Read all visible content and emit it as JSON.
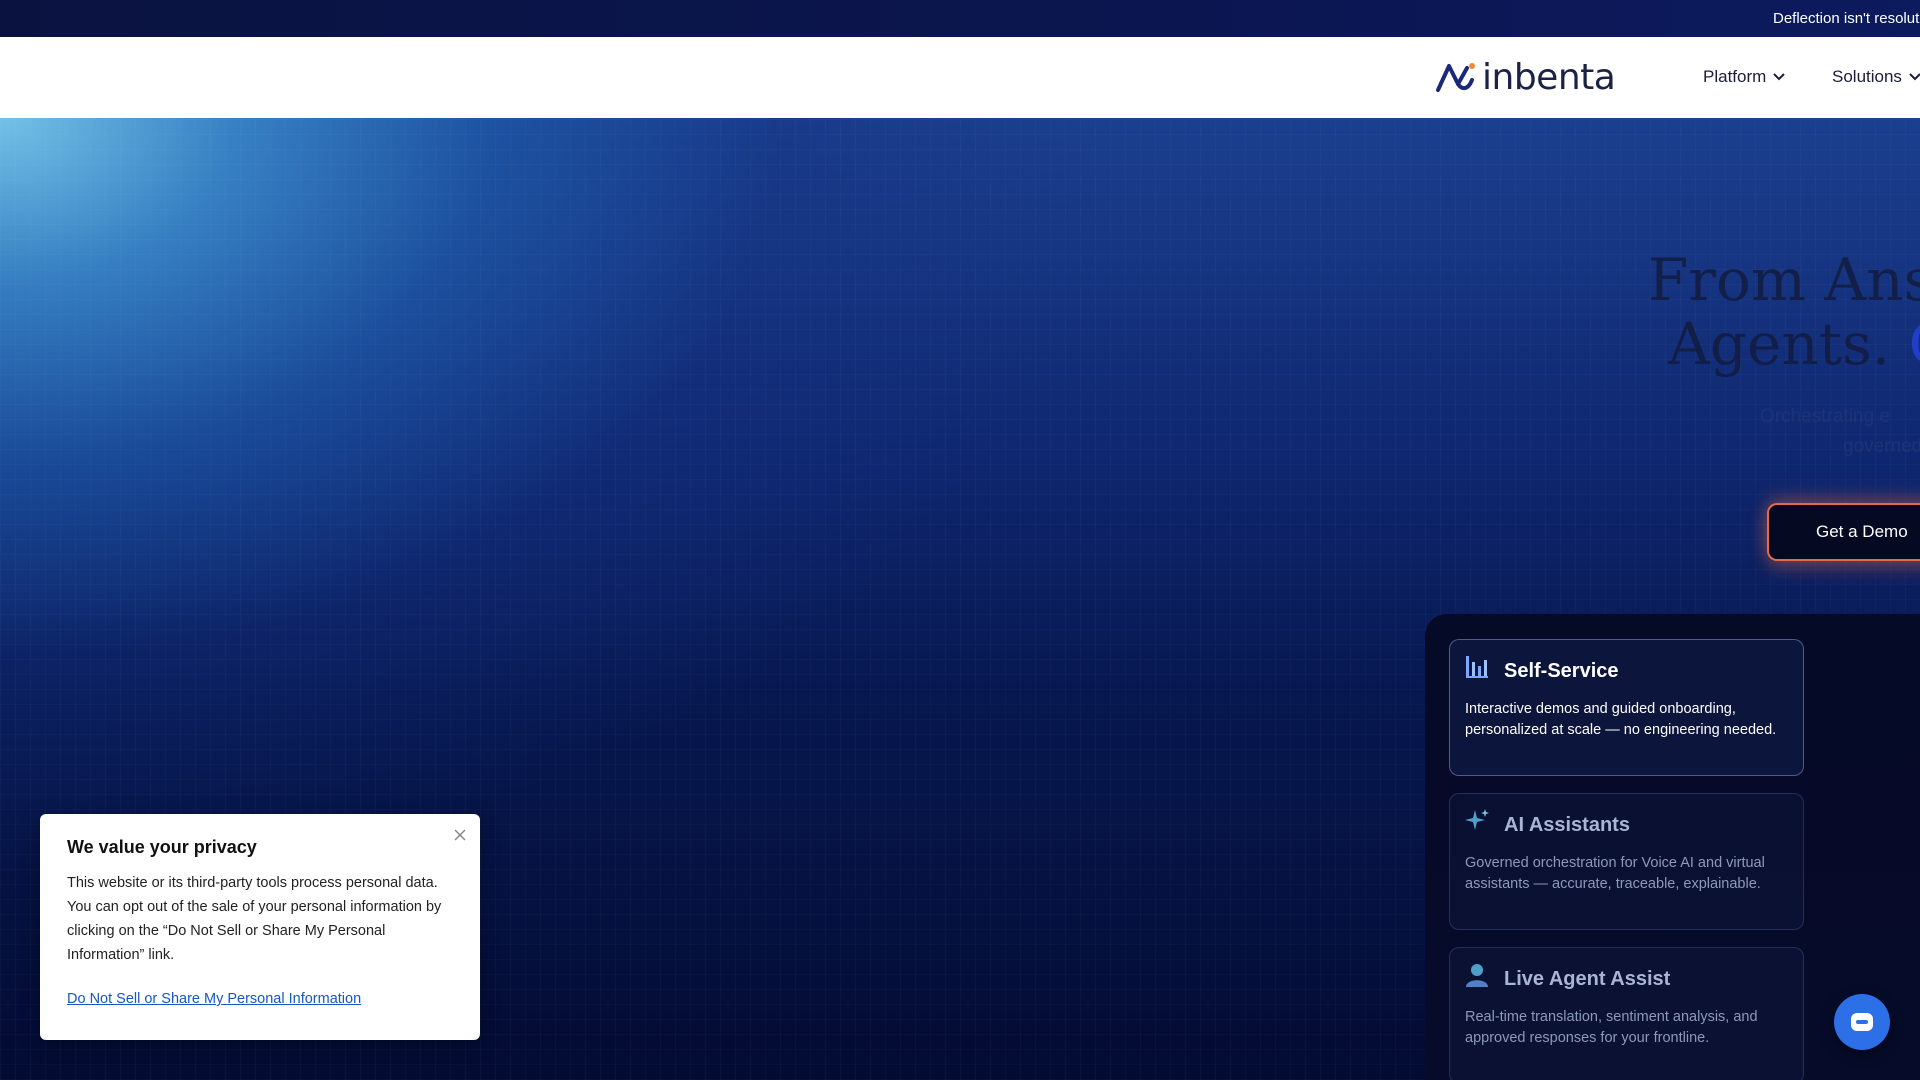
{
  "announcement": {
    "text": "Deflection isn't resolut"
  },
  "nav": {
    "logo_text": "inbenta",
    "items": [
      {
        "label": "Platform"
      },
      {
        "label": "Solutions"
      }
    ]
  },
  "hero": {
    "headline_line1": "From Ansv",
    "headline_line2_start": "Agents.",
    "headline_line2_accent": "Or",
    "subtext_line1": "Orchestrating e",
    "subtext_line2": "governed",
    "cta_label": "Get a Demo"
  },
  "cards": [
    {
      "title": "Self-Service",
      "desc": "Interactive demos and guided onboarding, personalized at scale — no engineering needed.",
      "icon": "bar-chart-icon"
    },
    {
      "title": "AI Assistants",
      "desc": "Governed orchestration for Voice AI and virtual assistants — accurate, traceable, explainable.",
      "icon": "sparkle-icon"
    },
    {
      "title": "Live Agent Assist",
      "desc": "Real-time translation, sentiment analysis, and approved responses for your frontline.",
      "icon": "person-icon"
    }
  ],
  "privacy": {
    "title": "We value your privacy",
    "body": "This website or its third-party tools process personal data. You can opt out of the sale of your personal information by clicking on the “Do Not Sell or Share My Personal Information” link.",
    "link": "Do Not Sell or Share My Personal Information"
  },
  "colors": {
    "accent": "#2740d6",
    "cta_border": "#e46a4a",
    "chat": "#2d6fe6"
  }
}
